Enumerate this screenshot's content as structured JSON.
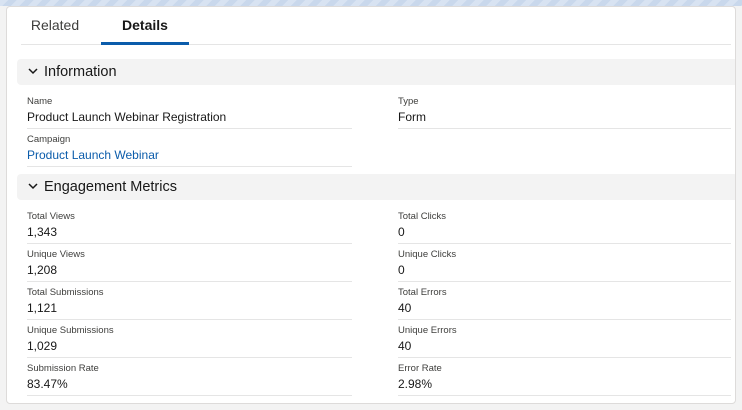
{
  "tabs": {
    "related": "Related",
    "details": "Details"
  },
  "information": {
    "title": "Information",
    "name_label": "Name",
    "name_value": "Product Launch Webinar Registration",
    "type_label": "Type",
    "type_value": "Form",
    "campaign_label": "Campaign",
    "campaign_value": "Product Launch Webinar"
  },
  "engagement": {
    "title": "Engagement Metrics",
    "total_views_label": "Total Views",
    "total_views": "1,343",
    "total_clicks_label": "Total Clicks",
    "total_clicks": "0",
    "unique_views_label": "Unique Views",
    "unique_views": "1,208",
    "unique_clicks_label": "Unique Clicks",
    "unique_clicks": "0",
    "total_submissions_label": "Total Submissions",
    "total_submissions": "1,121",
    "total_errors_label": "Total Errors",
    "total_errors": "40",
    "unique_submissions_label": "Unique Submissions",
    "unique_submissions": "1,029",
    "unique_errors_label": "Unique Errors",
    "unique_errors": "40",
    "submission_rate_label": "Submission Rate",
    "submission_rate": "83.47%",
    "error_rate_label": "Error Rate",
    "error_rate": "2.98%"
  },
  "icons": {
    "section_toggle": "chevron-down-icon"
  },
  "colors": {
    "link": "#0b5cab",
    "tab_active_underline": "#0b5cab",
    "section_bg": "#f3f3f3"
  }
}
